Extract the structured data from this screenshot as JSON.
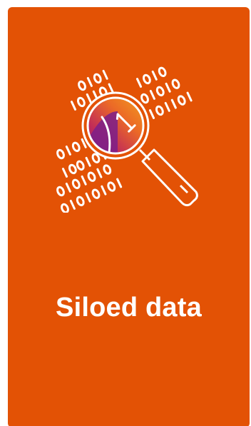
{
  "card": {
    "title": "Siloed data",
    "background_color": "#e35205",
    "icon": "binary-magnifier-icon"
  },
  "icon_colors": {
    "line": "#ffffff",
    "lens_yellow": "#f2b21c",
    "lens_magenta": "#b21f64",
    "lens_purple": "#7b1e8a"
  }
}
